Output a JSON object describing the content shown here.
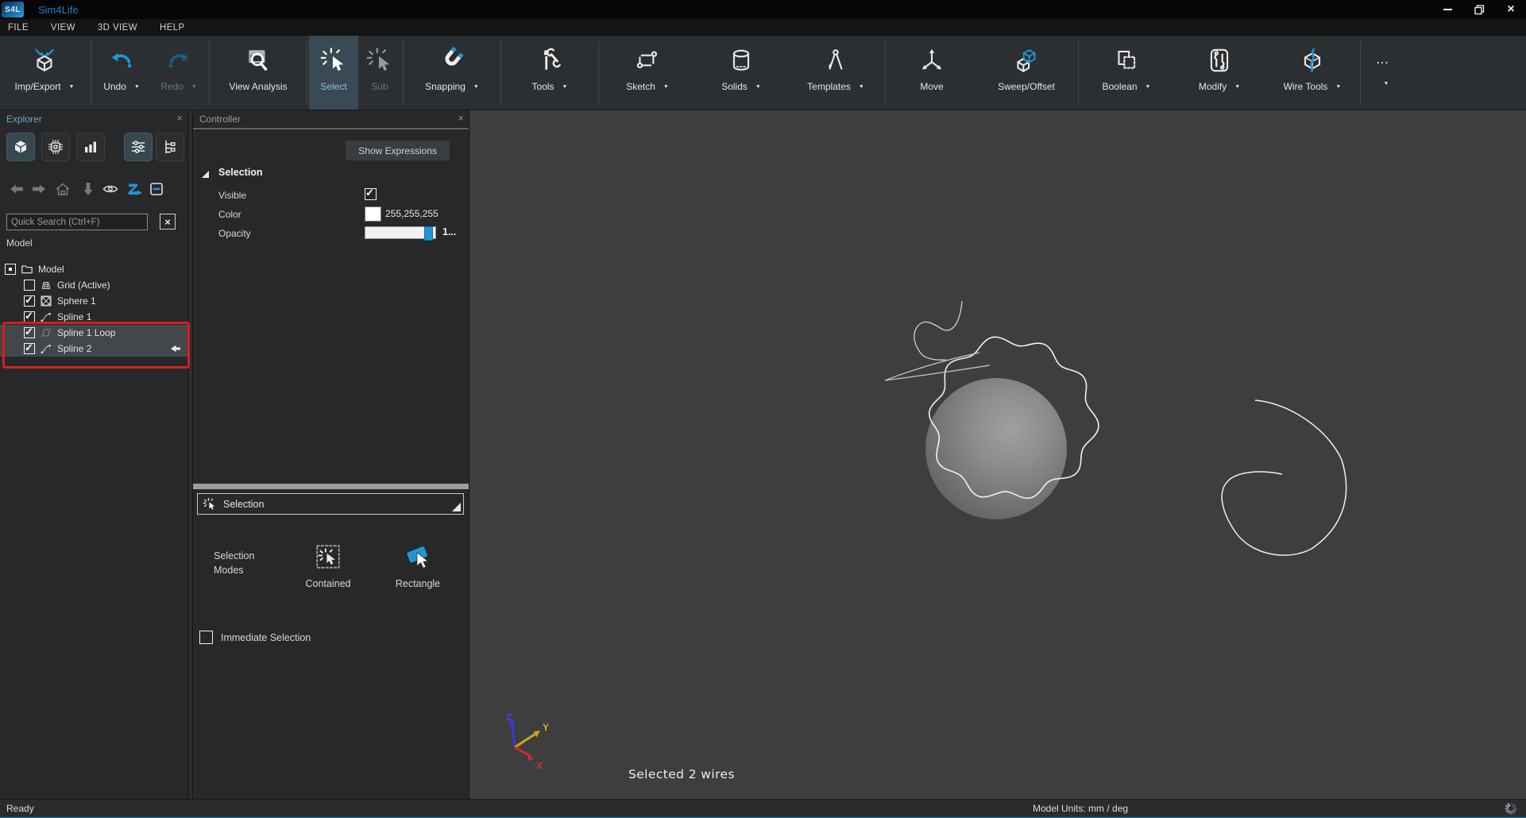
{
  "window": {
    "app_title": "Sim4Life",
    "logo_text": "S4L"
  },
  "menu": {
    "items": [
      "FILE",
      "VIEW",
      "3D VIEW",
      "HELP"
    ]
  },
  "toolbar": {
    "items": [
      {
        "label": "Imp/Export",
        "icon": "imp-export-icon",
        "dropdown": true,
        "sep": true
      },
      {
        "label": "Undo",
        "icon": "undo-icon",
        "dropdown": true
      },
      {
        "label": "Redo",
        "icon": "redo-icon",
        "dropdown": true,
        "state": "disabled",
        "sep": true
      },
      {
        "label": "View Analysis",
        "icon": "view-analysis-icon",
        "sep": true
      },
      {
        "label": "Select",
        "icon": "select-icon",
        "state": "active"
      },
      {
        "label": "Sub",
        "icon": "sub-icon",
        "state": "disabled",
        "sep": true
      },
      {
        "label": "Snapping",
        "icon": "snapping-icon",
        "dropdown": true,
        "sep": true
      },
      {
        "label": "Tools",
        "icon": "tools-icon",
        "dropdown": true,
        "sep": true
      },
      {
        "label": "Sketch",
        "icon": "sketch-icon",
        "dropdown": true
      },
      {
        "label": "Solids",
        "icon": "solids-icon",
        "dropdown": true
      },
      {
        "label": "Templates",
        "icon": "templates-icon",
        "dropdown": true,
        "sep": true
      },
      {
        "label": "Move",
        "icon": "move-icon"
      },
      {
        "label": "Sweep/Offset",
        "icon": "sweep-offset-icon",
        "sep": true
      },
      {
        "label": "Boolean",
        "icon": "boolean-icon",
        "dropdown": true
      },
      {
        "label": "Modify",
        "icon": "modify-icon",
        "dropdown": true
      },
      {
        "label": "Wire Tools",
        "icon": "wire-tools-icon",
        "dropdown": true,
        "sep": true
      },
      {
        "label": "",
        "icon": "overflow-icon",
        "dropdown": true
      }
    ]
  },
  "explorer": {
    "title": "Explorer",
    "top_buttons": [
      {
        "icon": "model-cube-icon",
        "active": true
      },
      {
        "icon": "chip-icon"
      },
      {
        "icon": "bar-chart-icon"
      },
      {
        "icon": "filter-sliders-icon",
        "active": true,
        "group2": true
      },
      {
        "icon": "tree-view-icon",
        "group2": true
      }
    ],
    "nav_buttons": [
      {
        "icon": "back-arrow-icon",
        "disabled": true
      },
      {
        "icon": "forward-arrow-icon",
        "disabled": true
      },
      {
        "icon": "home-icon",
        "disabled": true
      },
      {
        "icon": "down-arrow-icon",
        "disabled": true
      },
      {
        "icon": "eye-icon"
      },
      {
        "icon": "zoom-z-icon"
      },
      {
        "icon": "collapse-all-icon"
      }
    ],
    "search_placeholder": "Quick Search (Ctrl+F)",
    "clear_label": "×",
    "section_label": "Model",
    "tree": [
      {
        "label": "Model",
        "icon": "folder-icon",
        "checkbox": "partial",
        "depth": 0
      },
      {
        "label": "Grid (Active)",
        "icon": "grid-icon",
        "checkbox": "unchecked",
        "depth": 1
      },
      {
        "label": "Sphere 1",
        "icon": "sphere-icon",
        "checkbox": "checked",
        "depth": 1
      },
      {
        "label": "Spline 1",
        "icon": "spline-icon",
        "checkbox": "checked",
        "depth": 1
      },
      {
        "label": "Spline 1 Loop",
        "icon": "loop-icon",
        "checkbox": "checked",
        "depth": 1,
        "selected": true
      },
      {
        "label": "Spline 2",
        "icon": "spline-icon",
        "checkbox": "checked",
        "depth": 1,
        "selected": true,
        "badge_icon": "left-arrow-badge-icon"
      }
    ],
    "annotation_color": "#d21f1f"
  },
  "controller": {
    "title": "Controller",
    "show_expressions": "Show Expressions",
    "section_title": "Selection",
    "rows": {
      "visible": {
        "label": "Visible",
        "checked": true
      },
      "color": {
        "label": "Color",
        "swatch": "#ffffff",
        "value": "255,255,255"
      },
      "opacity": {
        "label": "Opacity",
        "value": "1..."
      }
    },
    "tool_header": "Selection",
    "modes_label": "Selection Modes",
    "modes": [
      {
        "label": "Contained",
        "icon": "contained-icon"
      },
      {
        "label": "Rectangle",
        "icon": "rectangle-icon"
      }
    ],
    "immediate_label": "Immediate Selection"
  },
  "viewport": {
    "status_text": "Selected 2 wires",
    "axis_labels": {
      "x": "X",
      "y": "Y",
      "z": "Z"
    }
  },
  "statusbar": {
    "ready": "Ready",
    "units": "Model Units: mm / deg"
  },
  "colors": {
    "accent": "#2196d3",
    "annotation": "#d21f1f",
    "accent_bar": "#1587c8"
  }
}
